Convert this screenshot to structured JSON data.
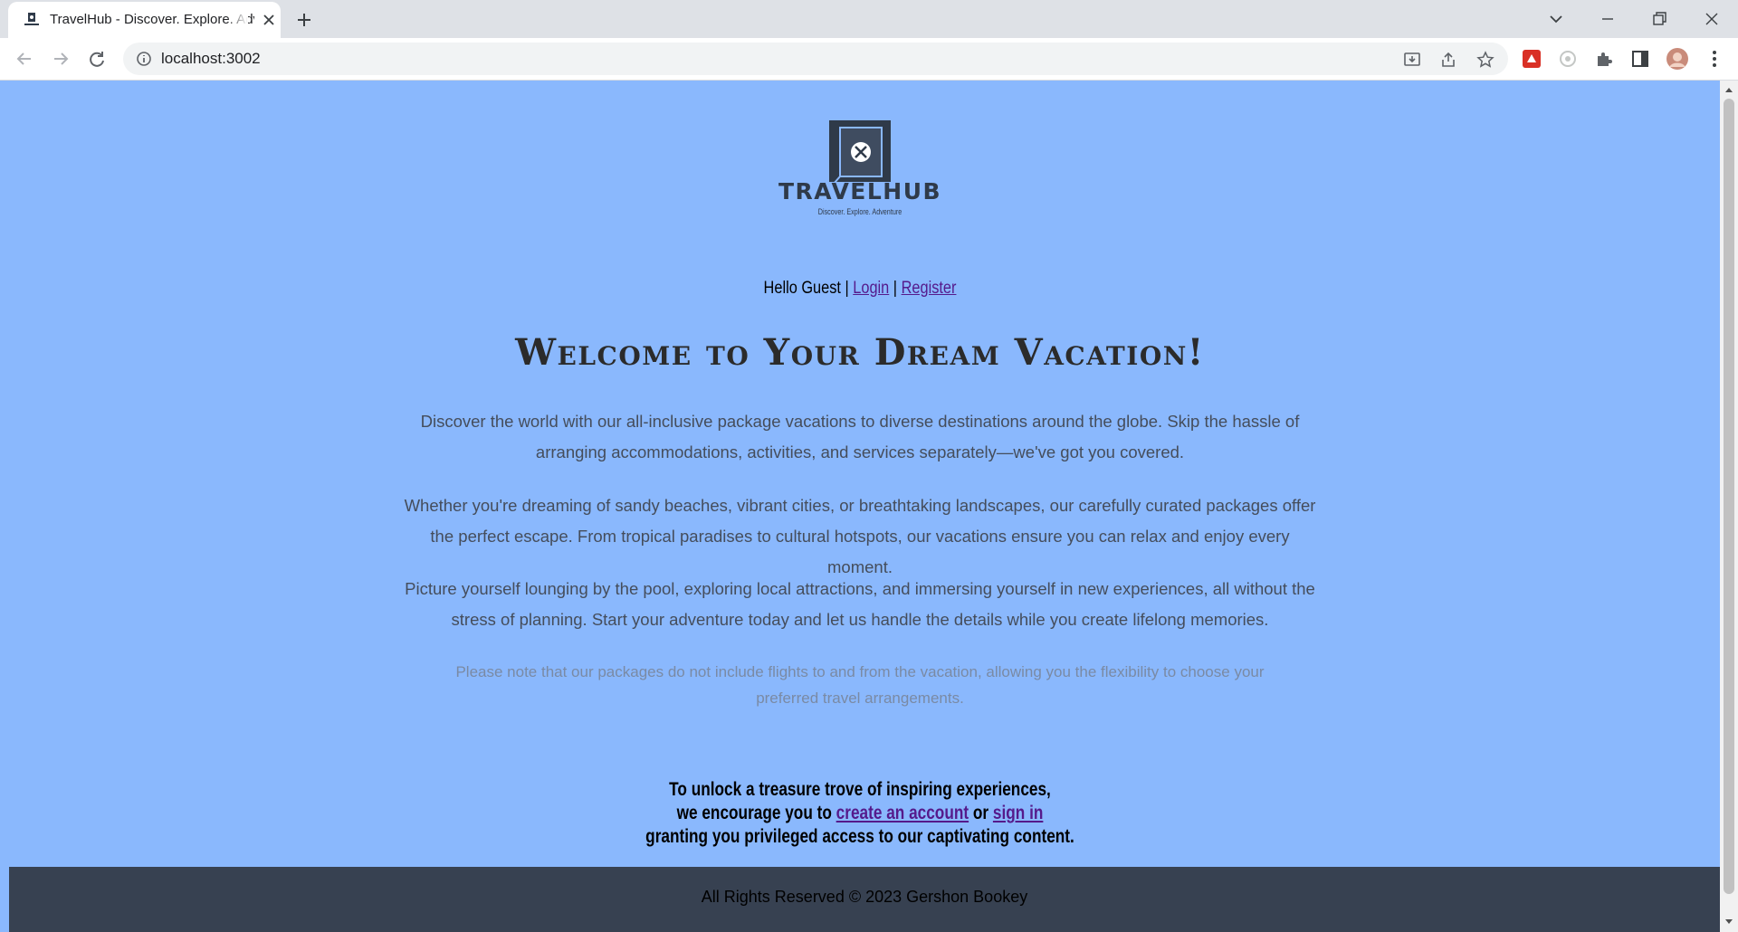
{
  "browser": {
    "tab_title": "TravelHub - Discover. Explore. Adventure",
    "url": "localhost:3002"
  },
  "brand": {
    "name": "TRAVELHUB",
    "tagline": "Discover. Explore. Adventure",
    "color": "#2f3a49"
  },
  "header": {
    "greeting": "Hello Guest",
    "separator": "|",
    "login_label": "Login",
    "register_label": "Register"
  },
  "main": {
    "headline": "Welcome to Your Dream Vacation!",
    "paragraphs": [
      "Discover the world with our all-inclusive package vacations to diverse destinations around the globe. Skip the hassle of arranging accommodations, activities, and services separately—we've got you covered.",
      "Whether you're dreaming of sandy beaches, vibrant cities, or breathtaking landscapes, our carefully curated packages offer the perfect escape. From tropical paradises to cultural hotspots, our vacations ensure you can relax and enjoy every moment.",
      "Picture yourself lounging by the pool, exploring local attractions, and immersing yourself in new experiences, all without the stress of planning. Start your adventure today and let us handle the details while you create lifelong memories."
    ],
    "note": "Please note that our packages do not include flights to and from the vacation, allowing you the flexibility to choose your preferred travel arrangements."
  },
  "cta": {
    "line1": "To unlock a treasure trove of inspiring experiences,",
    "line2_prefix": "we encourage you to",
    "create_account_label": "create an account",
    "or_text": "or",
    "sign_in_label": "sign in",
    "line3": "granting you privileged access to our captivating content."
  },
  "footer": {
    "text": "All Rights Reserved © 2023 Gershon Bookey"
  },
  "colors": {
    "page_background": "#8ab8fd",
    "footer_background": "#374151",
    "visited_link": "#551a8b"
  }
}
